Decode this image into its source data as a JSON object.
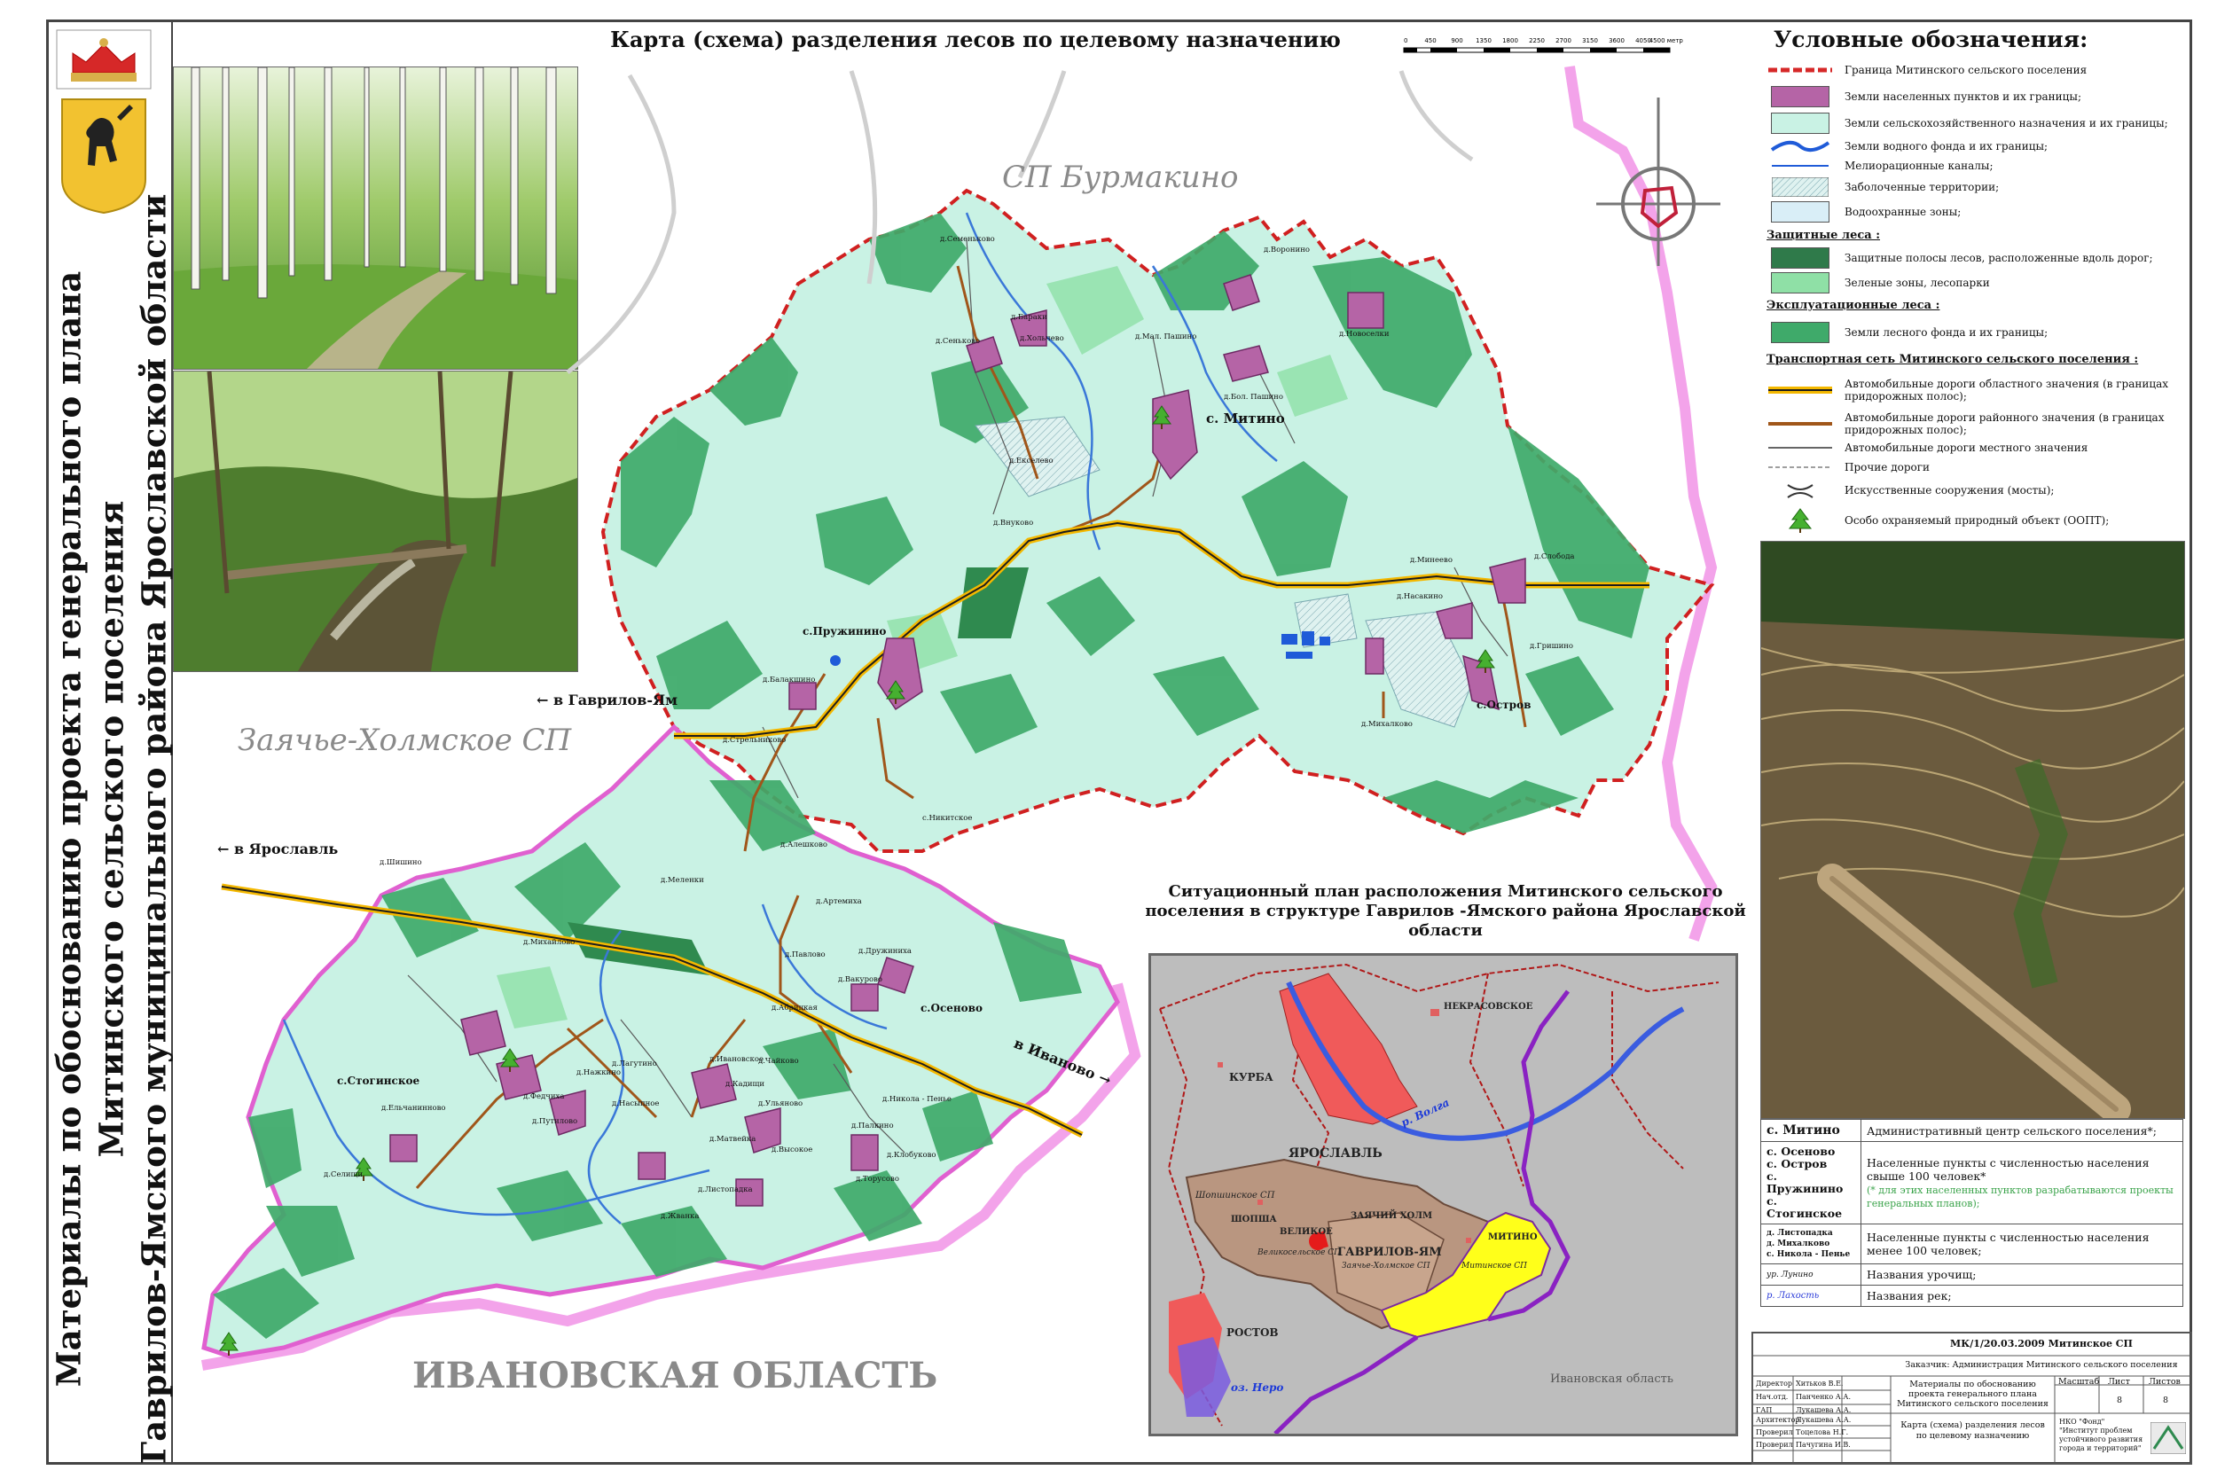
{
  "side_title": {
    "line1": "Материалы по обоснованию проекта генерального плана",
    "line2": "Митинского сельского поселения",
    "line3": "Гаврилов-Ямского муниципального района Ярославской области"
  },
  "map_title": "Карта (схема) разделения лесов по целевому назначению",
  "scale": {
    "ticks": [
      "0",
      "450",
      "900",
      "1350",
      "1800",
      "2250",
      "2700",
      "3150",
      "3600",
      "4050",
      "4500 метров"
    ]
  },
  "legend": {
    "title": "Условные обозначения:",
    "items": [
      {
        "symbol": "red-dashed-line",
        "label": "Граница Митинского сельского поселения"
      },
      {
        "symbol": "purple-area",
        "label": "Земли населенных пунктов и их границы;"
      },
      {
        "symbol": "mint-area",
        "label": "Земли сельскохозяйственного назначения и их границы;"
      },
      {
        "symbol": "blue-wave-line",
        "label": "Земли водного фонда и их границы;"
      },
      {
        "symbol": "blue-line",
        "label": "Мелиорационные каналы;"
      },
      {
        "symbol": "hatched-area",
        "label": "Заболоченные территории;"
      },
      {
        "symbol": "light-blue-area",
        "label": "Водоохранные зоны;"
      }
    ],
    "section_protective": "Защитные леса :",
    "protective_items": [
      {
        "symbol": "dark-green-area",
        "label": "Защитные полосы лесов, расположенные вдоль дорог;"
      },
      {
        "symbol": "light-green-area",
        "label": "Зеленые зоны, лесопарки"
      }
    ],
    "section_exploitation": "Эксплуатационные леса :",
    "exploitation_items": [
      {
        "symbol": "green-area",
        "label": "Земли лесного фонда и их границы;"
      }
    ],
    "section_transport": "Транспортная сеть Митинского сельского поселения :",
    "transport_items": [
      {
        "symbol": "regional-road",
        "label": "Автомобильные дороги областного значения (в границах придорожных полос);"
      },
      {
        "symbol": "district-road",
        "label": "Автомобильные дороги районного значения (в границах придорожных полос);"
      },
      {
        "symbol": "local-road",
        "label": "Автомобильные дороги местного значения"
      },
      {
        "symbol": "other-road",
        "label": "Прочие дороги"
      },
      {
        "symbol": "bridge",
        "label": "Искусственные сооружения (мосты);"
      },
      {
        "symbol": "protected-object",
        "label": "Особо охраняемый природный объект (ООПТ);"
      }
    ]
  },
  "map": {
    "regions": {
      "north": "СП Бурмакино",
      "west": "Заячье-Холмское СП",
      "south": "ИВАНОВСКАЯ ОБЛАСТЬ"
    },
    "directions": {
      "gavrilov_yam": "← в Гаврилов-Ям",
      "yaroslavl": "← в Ярославль",
      "ivanovo": "в Иваново →"
    },
    "big_places": [
      "с. Митино",
      "с.Пружинино",
      "с.Остров",
      "с.Осеново",
      "с.Стогинское"
    ],
    "villages": [
      "д.Воронино",
      "д.Новоселки",
      "д.Семеньково",
      "д.Бараки",
      "д.Хольчево",
      "д.Мал. Пашино",
      "д.Бол. Пашино",
      "д.Сеньково",
      "д.Екселево",
      "д.Внуково",
      "д.Минеево",
      "д.Слобода",
      "д.Насакино",
      "д.Гришино",
      "д.Михалково",
      "д.Балакшино",
      "д.Стрельниково",
      "с.Никитское",
      "д.Алешково",
      "д.Меленки",
      "д.Артемиха",
      "д.Павлово",
      "д.Дружиниха",
      "д.Вакурово",
      "д.Абрицкая",
      "д.Ивановское",
      "д.Чайково",
      "д.Кадищи",
      "д.Ульяново",
      "д.Никола - Пенье",
      "д.Палкино",
      "д.Высокое",
      "д.Клобуково",
      "д.Торусово",
      "д.Лагутино",
      "д.Насыпное",
      "д.Матвейка",
      "д.Листопадка",
      "д.Жванка",
      "д.Федчиха",
      "д.Путилово",
      "д.Ельчанинново",
      "д.Селищи",
      "д.Михайлово",
      "д.Шишино",
      "д.Нажкино"
    ]
  },
  "inset": {
    "title": "Ситуационный план расположения Митинского сельского поселения в структуре Гаврилов -Ямского района Ярославской области",
    "labels": {
      "kurba": "КУРБА",
      "nekrasovskoe": "НЕКРАСОВСКОЕ",
      "yaroslavl": "ЯРОСЛАВЛЬ",
      "volga": "р. Волга",
      "shopsha_sp": "Шопшинское СП",
      "shopsha": "ШОПША",
      "zayachy": "ЗАЯЧИЙ ХОЛМ",
      "velikoe": "ВЕЛИКОЕ",
      "velikoe_sp": "Великосельское СП",
      "gavrilov": "ГАВРИЛОВ-ЯМ",
      "zayachy_sp": "Заячье-Холмское СП",
      "mitino": "МИТИНО",
      "mitino_sp": "Митинское СП",
      "rostov": "РОСТОВ",
      "nero": "оз. Неро",
      "ivanovo_region": "Ивановская область"
    }
  },
  "definitions": [
    {
      "key": "с. Митино",
      "value": "Административный центр сельского поселения*;"
    },
    {
      "key": "с. Осеново\nс. Остров\nс. Пружинино\nс. Стогинское",
      "value": "Населенные пункты с численностью населения свыше 100 человек*",
      "note": "(* для этих населенных пунктов разрабатываются проекты генеральных планов);"
    },
    {
      "key": "д. Листопадка\nд. Михалково\nс. Никола - Пенье",
      "value": "Населенные пункты с численностью населения менее 100 человек;"
    },
    {
      "key": "ур. Лунино",
      "value": "Названия урочищ;"
    },
    {
      "key": "р. Лахость",
      "value": "Названия рек;"
    }
  ],
  "stamp": {
    "doc_number": "МК/1/20.03.2009 Митинское СП",
    "customer": "Заказчик: Администрация Митинского сельского поселения",
    "project": "Материалы по обоснованию проекта генерального плана Митинского сельского поселения",
    "sheet_title": "Карта (схема) разделения лесов по целевому назначению",
    "org": "НКО \"Фонд\" \"Институт проблем устойчивого развития города и территорий\"",
    "col_scale": "Масштаб",
    "col_sheet": "Лист",
    "col_sheets": "Листов",
    "sheet_val": "8",
    "sheets_val": "8",
    "roles": [
      "Директор",
      "Нач.отд.",
      "ГАП",
      "Архитектор",
      "Проверил",
      "Проверил"
    ],
    "names": [
      "Хитьков В.Е.",
      "Панченко А.А.",
      "Лукашева А.А.",
      "Лукашева А.А.",
      "Тоцелова Н.Г.",
      "Пачугина И.В."
    ]
  }
}
